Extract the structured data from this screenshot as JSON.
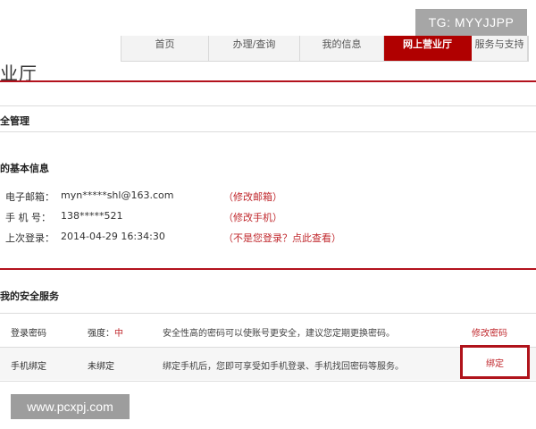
{
  "nav": {
    "tabs": [
      {
        "label": "首页",
        "active": false
      },
      {
        "label": "办理/查询",
        "active": false
      },
      {
        "label": "我的信息",
        "active": false
      },
      {
        "label": "网上营业厅",
        "active": true
      },
      {
        "label": "服务与支持",
        "active": false
      }
    ]
  },
  "page_title": "业厅",
  "sections": {
    "security_title": "全管理",
    "basic_info_title": "的基本信息",
    "services_title": "我的安全服务"
  },
  "basic_info": [
    {
      "label": "电子邮箱：",
      "value": "myn*****shl@163.com",
      "link": "（修改邮箱）"
    },
    {
      "label": "手 机 号：",
      "value": "138*****521",
      "link": "（修改手机）"
    },
    {
      "label": "上次登录：",
      "value": "2014-04-29 16:34:30",
      "link": "（不是您登录？点此查看）"
    }
  ],
  "services": [
    {
      "name": "登录密码",
      "status_prefix": "强度：",
      "status_value": "中",
      "desc": "安全性高的密码可以使账号更安全，建议您定期更换密码。",
      "action": "修改密码"
    },
    {
      "name": "手机绑定",
      "status_prefix": "",
      "status_value": "未绑定",
      "desc": "绑定手机后，您即可享受如手机登录、手机找回密码等服务。",
      "action": "绑定"
    }
  ],
  "watermarks": {
    "tg": "TG: MYYJJPP",
    "site": "www.pcxpj.com"
  },
  "colors": {
    "accent": "#b00000",
    "link": "#c0282d"
  }
}
